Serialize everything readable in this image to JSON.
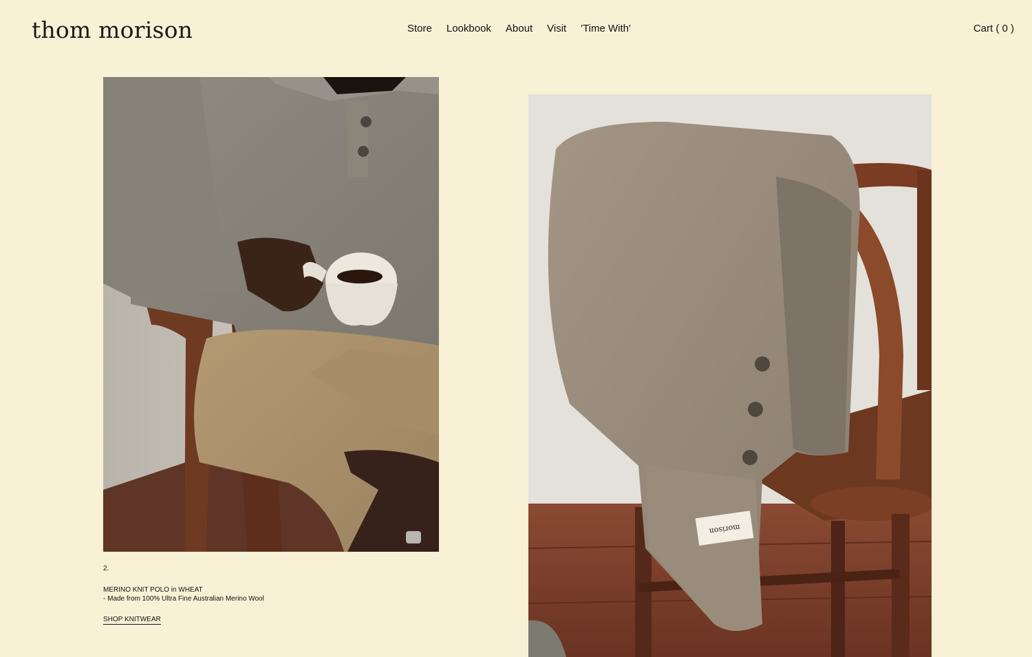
{
  "header": {
    "logo": "thom morison",
    "nav": [
      {
        "label": "Store"
      },
      {
        "label": "Lookbook"
      },
      {
        "label": "About"
      },
      {
        "label": "Visit"
      },
      {
        "label": "'Time With'"
      }
    ],
    "cart_label": "Cart",
    "cart_count": "( 0 )"
  },
  "images": {
    "left": {
      "subject": "model-in-merino-polo-holding-coffee-cup"
    },
    "right": {
      "subject": "knit-polo-draped-over-wooden-chair",
      "tag_text": "morison"
    }
  },
  "caption": {
    "number": "2.",
    "title": "MERINO KNIT POLO in WHEAT",
    "description": "- Made from 100% Ultra Fine Australian Merino Wool",
    "link": "SHOP KNITWEAR"
  },
  "colors": {
    "background": "#f8f1d5",
    "text": "#111111"
  }
}
